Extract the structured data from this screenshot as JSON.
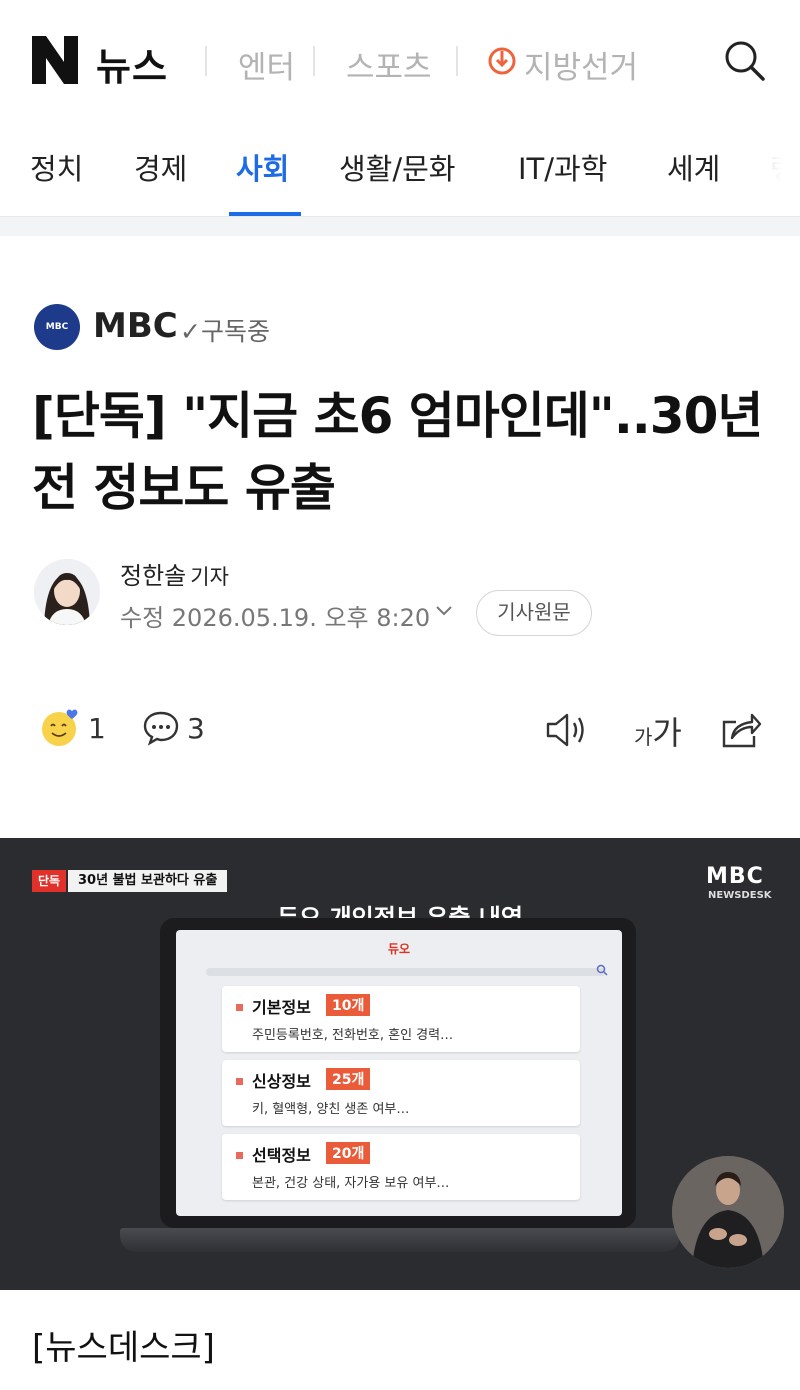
{
  "header": {
    "logo": "N",
    "brand": "뉴스",
    "nav": [
      "엔터",
      "스포츠",
      "지방선거"
    ]
  },
  "categories": {
    "items": [
      "정치",
      "경제",
      "사회",
      "생활/문화",
      "IT/과학",
      "세계",
      "랭"
    ],
    "active": "사회"
  },
  "press": {
    "name": "MBC",
    "logo_text": "MBC NEWS",
    "subscribe_label": "✓구독중"
  },
  "article": {
    "headline": "[단독] \"지금 초6 엄마인데\"..30년 전 정보도 유출",
    "reporter_name": "정한솔",
    "reporter_role": "기자",
    "timestamp": "수정 2026.05.19. 오후 8:20",
    "original_label": "기사원문",
    "section_label": "[뉴스데스크]"
  },
  "actions": {
    "reactions": "1",
    "comments": "3",
    "font_label_small": "가",
    "font_label_large": "가"
  },
  "broadcast": {
    "exclusive_tag": "단독",
    "banner": "30년 불법 보관하다 유출",
    "channel": "MBC",
    "channel_sub": "NEWSDESK",
    "title": "듀오 개인정보 유출 내역",
    "screen_logo": "듀오",
    "cards": [
      {
        "title": "기본정보",
        "count": "10개",
        "desc": "주민등록번호, 전화번호, 혼인 경력…"
      },
      {
        "title": "신상정보",
        "count": "25개",
        "desc": "키, 혈액형, 양친 생존 여부…"
      },
      {
        "title": "선택정보",
        "count": "20개",
        "desc": "본관, 건강 상태, 자가용 보유 여부…"
      }
    ]
  },
  "colors": {
    "accent": "#1e6be6",
    "press_blue": "#1e3a8a",
    "count_orange": "#ea5b3a",
    "exclusive_red": "#e0322a"
  }
}
